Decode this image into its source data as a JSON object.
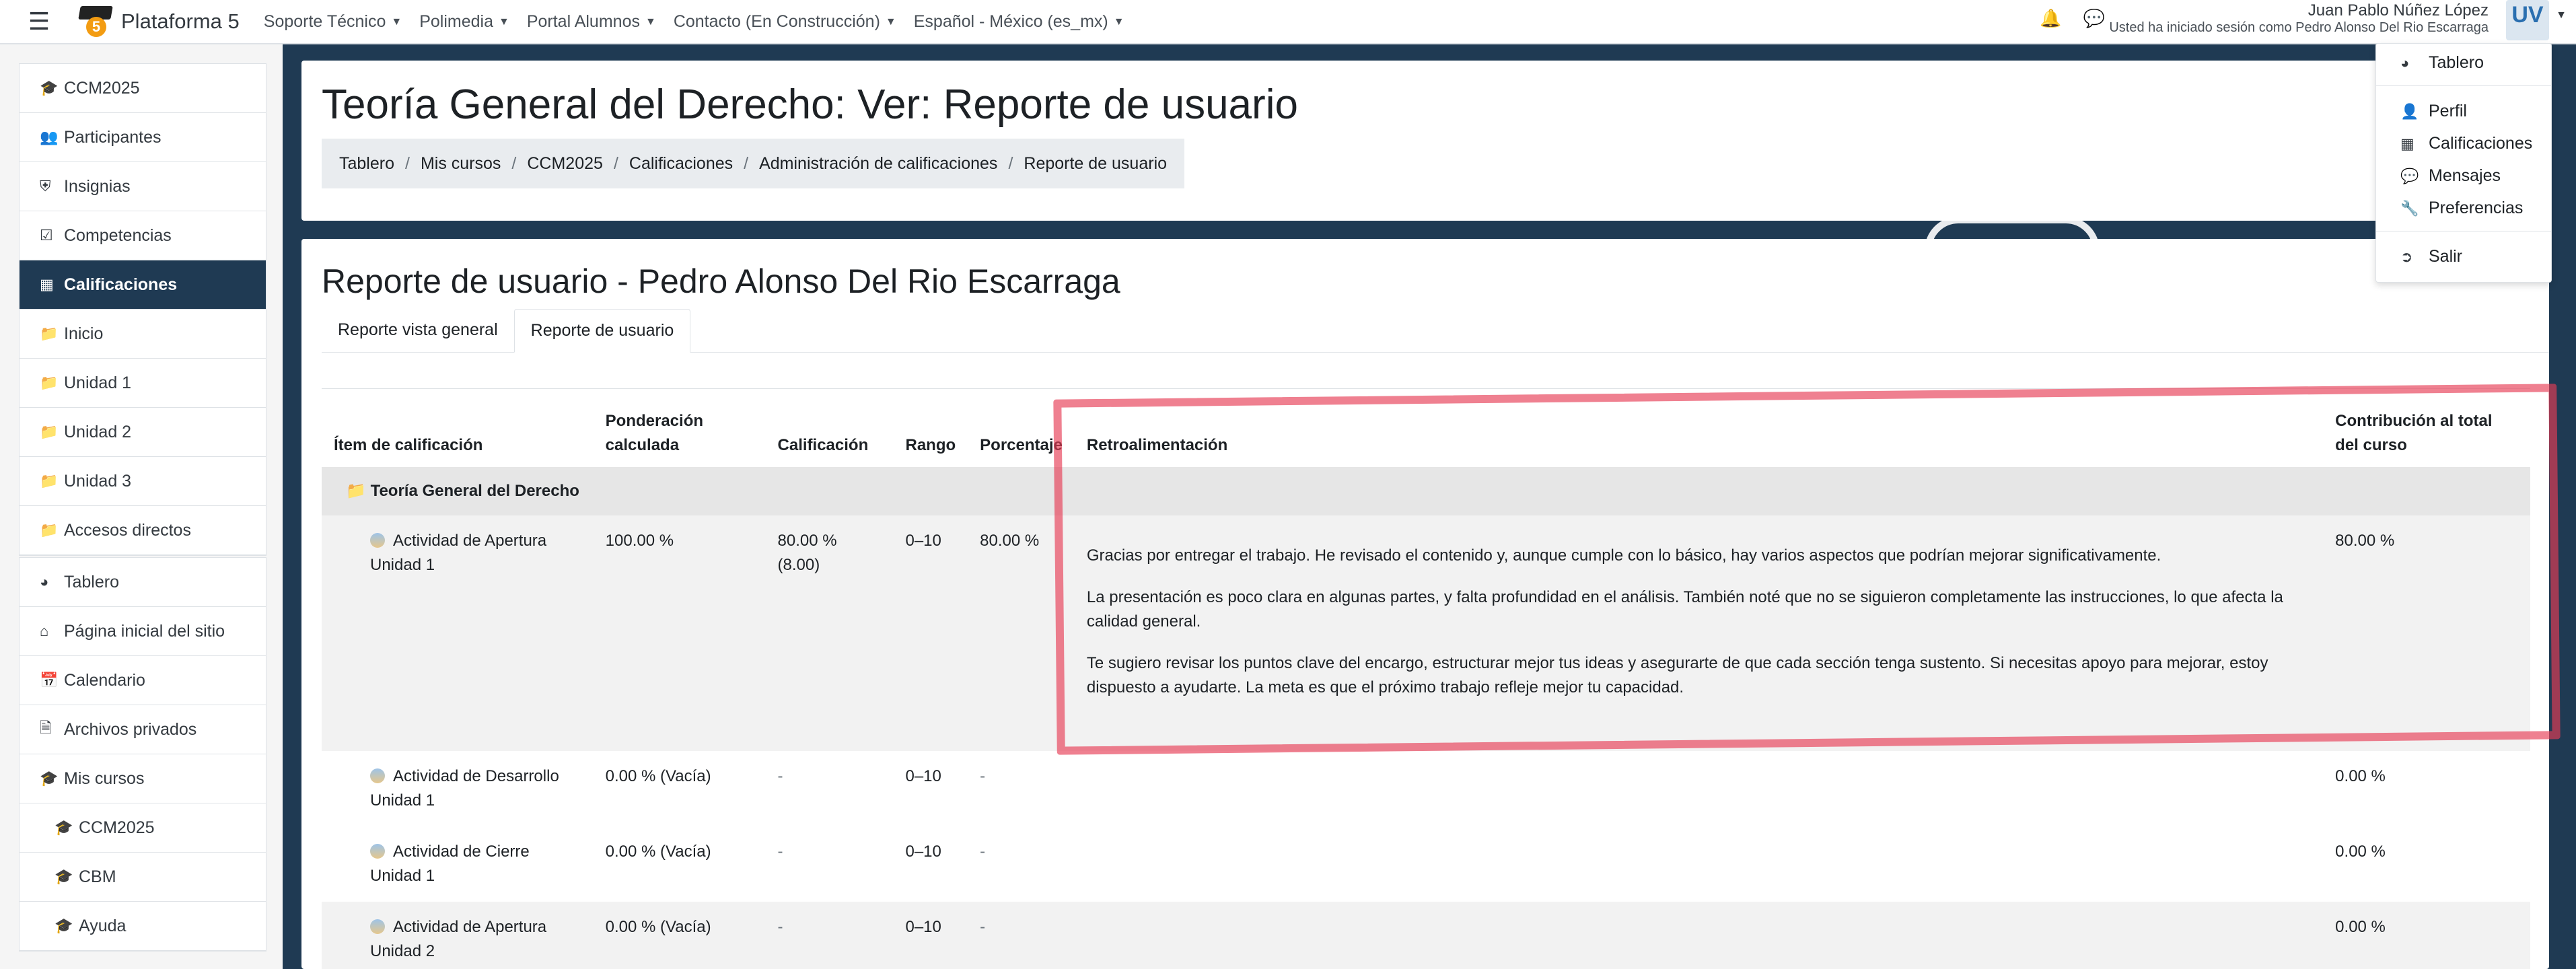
{
  "navbar": {
    "brand": "Plataforma 5",
    "brand_number": "5",
    "menu": [
      {
        "label": "Soporte Técnico"
      },
      {
        "label": "Polimedia"
      },
      {
        "label": "Portal Alumnos"
      },
      {
        "label": "Contacto (En Construcción)"
      },
      {
        "label": "Español - México (es_mx)"
      }
    ],
    "user_name": "Juan Pablo Núñez López",
    "logged_in_as": "Usted ha iniciado sesión como Pedro Alonso Del Rio Escarraga",
    "avatar_text": "UV",
    "icons": [
      "menu-icon",
      "bell-icon",
      "chat-icon"
    ]
  },
  "drawer": {
    "course_items": [
      {
        "label": "CCM2025",
        "icon": "graduation-cap-icon"
      },
      {
        "label": "Participantes",
        "icon": "users-icon"
      },
      {
        "label": "Insignias",
        "icon": "shield-icon"
      },
      {
        "label": "Competencias",
        "icon": "check-square-icon"
      },
      {
        "label": "Calificaciones",
        "icon": "table-icon",
        "active": true
      },
      {
        "label": "Inicio",
        "icon": "folder-icon"
      },
      {
        "label": "Unidad 1",
        "icon": "folder-icon"
      },
      {
        "label": "Unidad 2",
        "icon": "folder-icon"
      },
      {
        "label": "Unidad 3",
        "icon": "folder-icon"
      },
      {
        "label": "Accesos directos",
        "icon": "folder-icon"
      }
    ],
    "site_items": [
      {
        "label": "Tablero",
        "icon": "dashboard-icon"
      },
      {
        "label": "Página inicial del sitio",
        "icon": "home-icon"
      },
      {
        "label": "Calendario",
        "icon": "calendar-icon"
      },
      {
        "label": "Archivos privados",
        "icon": "file-icon"
      },
      {
        "label": "Mis cursos",
        "icon": "graduation-cap-icon"
      },
      {
        "label": "CCM2025",
        "icon": "graduation-cap-icon"
      },
      {
        "label": "CBM",
        "icon": "graduation-cap-icon"
      },
      {
        "label": "Ayuda",
        "icon": "graduation-cap-icon"
      }
    ]
  },
  "header": {
    "title": "Teoría General del Derecho: Ver: Reporte de usuario",
    "breadcrumb": [
      "Tablero",
      "Mis cursos",
      "CCM2025",
      "Calificaciones",
      "Administración de calificaciones",
      "Reporte de usuario"
    ]
  },
  "report": {
    "title": "Reporte de usuario - Pedro Alonso Del Rio Escarraga",
    "tabs": [
      {
        "label": "Reporte vista general",
        "active": false
      },
      {
        "label": "Reporte de usuario",
        "active": true
      }
    ],
    "columns": {
      "item": "Ítem de calificación",
      "weight": "Ponderación calculada",
      "grade": "Calificación",
      "range": "Rango",
      "percentage": "Porcentaje",
      "feedback": "Retroalimentación",
      "contribution": "Contribución al total del curso"
    },
    "category": "Teoría General del Derecho",
    "rows": [
      {
        "item": "Actividad de Apertura Unidad 1",
        "weight": "100.00 %",
        "grade": "80.00 % (8.00)",
        "range": "0–10",
        "percentage": "80.00 %",
        "feedback": [
          "Gracias por entregar el trabajo. He revisado el contenido y, aunque cumple con lo básico, hay varios aspectos que podrían mejorar significativamente.",
          "La presentación es poco clara en algunas partes, y falta profundidad en el análisis. También noté que no se siguieron completamente las instrucciones, lo que afecta la calidad general.",
          "Te sugiero revisar los puntos clave del encargo, estructurar mejor tus ideas y asegurarte de que cada sección tenga sustento. Si necesitas apoyo para mejorar, estoy dispuesto a ayudarte. La meta es que el próximo trabajo refleje mejor tu capacidad."
        ],
        "contribution": "80.00 %"
      },
      {
        "item": "Actividad de Desarrollo Unidad 1",
        "weight": "0.00 % (Vacía)",
        "grade": "-",
        "range": "0–10",
        "percentage": "-",
        "contribution": "0.00 %"
      },
      {
        "item": "Actividad de Cierre Unidad 1",
        "weight": "0.00 % (Vacía)",
        "grade": "-",
        "range": "0–10",
        "percentage": "-",
        "contribution": "0.00 %"
      },
      {
        "item": "Actividad de Apertura Unidad 2",
        "weight": "0.00 % (Vacía)",
        "grade": "-",
        "range": "0–10",
        "percentage": "-",
        "contribution": "0.00 %"
      }
    ]
  },
  "user_menu": [
    {
      "label": "Tablero",
      "icon": "dashboard-icon"
    },
    {
      "label": "Perfil",
      "icon": "user-icon"
    },
    {
      "label": "Calificaciones",
      "icon": "table-icon"
    },
    {
      "label": "Mensajes",
      "icon": "chat-icon"
    },
    {
      "label": "Preferencias",
      "icon": "wrench-icon"
    },
    {
      "label": "Salir",
      "icon": "sign-out-icon"
    }
  ],
  "colors": {
    "drawer_active": "#1f3a53",
    "highlight": "#e63c55",
    "page_bg": "#1f3a53"
  }
}
